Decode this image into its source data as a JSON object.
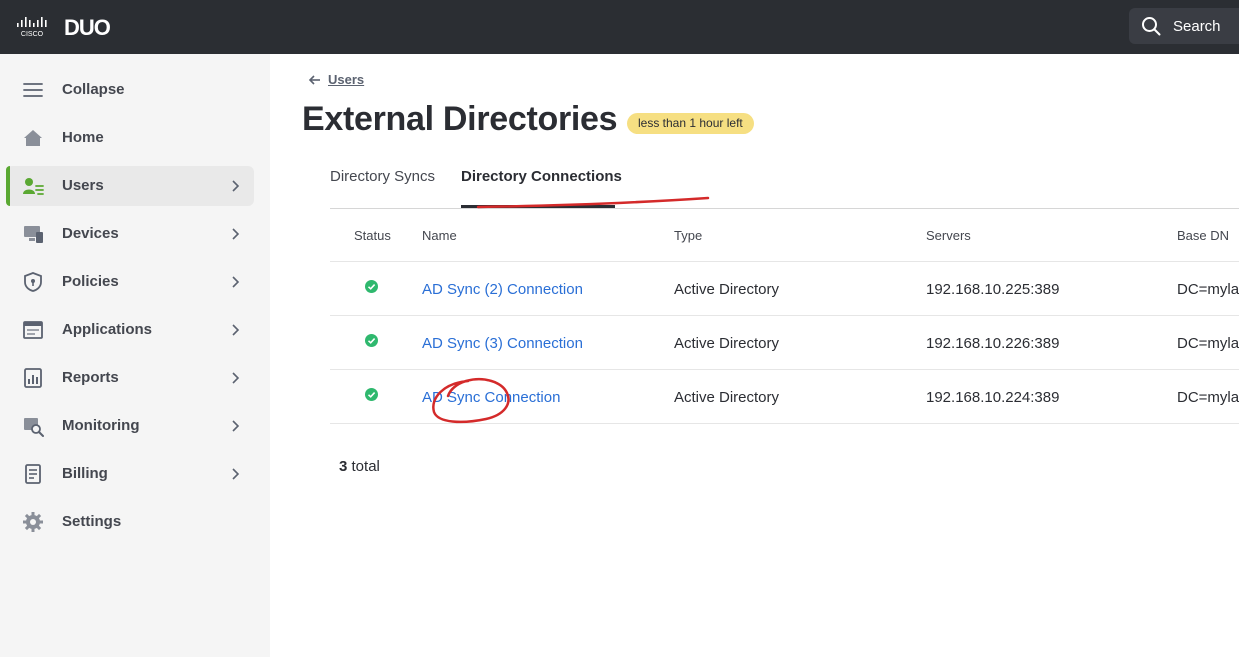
{
  "topbar": {
    "brand": "CISCO",
    "product": "DUO",
    "search_label": "Search"
  },
  "sidebar": {
    "items": [
      {
        "label": "Collapse",
        "icon": "menu-icon",
        "chevron": false,
        "active": false
      },
      {
        "label": "Home",
        "icon": "home-icon",
        "chevron": false,
        "active": false
      },
      {
        "label": "Users",
        "icon": "users-icon",
        "chevron": true,
        "active": true
      },
      {
        "label": "Devices",
        "icon": "devices-icon",
        "chevron": true,
        "active": false
      },
      {
        "label": "Policies",
        "icon": "shield-icon",
        "chevron": true,
        "active": false
      },
      {
        "label": "Applications",
        "icon": "applications-icon",
        "chevron": true,
        "active": false
      },
      {
        "label": "Reports",
        "icon": "reports-icon",
        "chevron": true,
        "active": false
      },
      {
        "label": "Monitoring",
        "icon": "monitoring-icon",
        "chevron": true,
        "active": false
      },
      {
        "label": "Billing",
        "icon": "billing-icon",
        "chevron": true,
        "active": false
      },
      {
        "label": "Settings",
        "icon": "gear-icon",
        "chevron": false,
        "active": false
      }
    ]
  },
  "breadcrumb": {
    "label": "Users"
  },
  "page": {
    "title": "External Directories",
    "badge": "less than 1 hour left"
  },
  "tabs": [
    {
      "label": "Directory Syncs",
      "active": false
    },
    {
      "label": "Directory Connections",
      "active": true
    }
  ],
  "table": {
    "columns": [
      "Status",
      "Name",
      "Type",
      "Servers",
      "Base DN"
    ],
    "rows": [
      {
        "status": "ok",
        "name": "AD Sync (2) Connection",
        "type": "Active Directory",
        "servers": "192.168.10.225:389",
        "base_dn": "DC=mylab"
      },
      {
        "status": "ok",
        "name": "AD Sync (3) Connection",
        "type": "Active Directory",
        "servers": "192.168.10.226:389",
        "base_dn": "DC=mylab"
      },
      {
        "status": "ok",
        "name": "AD Sync Connection",
        "type": "Active Directory",
        "servers": "192.168.10.224:389",
        "base_dn": "DC=mylab"
      }
    ],
    "total_count": "3",
    "total_suffix": " total"
  },
  "colors": {
    "topbar": "#2b2e33",
    "accent_green": "#5aa832",
    "link_blue": "#2a6fd6",
    "status_ok": "#2fb86e",
    "badge_yellow": "#f6df82",
    "annotation_red": "#d42a2a"
  }
}
